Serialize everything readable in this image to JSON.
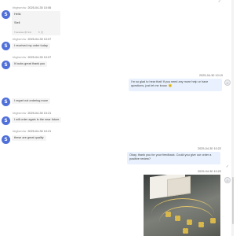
{
  "messages": {
    "m1": {
      "avatar": "S",
      "nick": "bbgtsmdw",
      "time": "2025-04-30 10:06",
      "lines": [
        "Hello",
        "Stell"
      ],
      "translate": "Translate  中  N/A",
      "translate_extra": "↻ 文"
    },
    "m2": {
      "avatar": "S",
      "nick": "bbgtsmdw",
      "time": "2025-04-30 10:07",
      "text": "I received my order today"
    },
    "m3": {
      "avatar": "S",
      "nick": "bbgtsmdw",
      "time": "2025-04-30 10:07",
      "text": "It looks great thank you"
    },
    "m4": {
      "time": "2025-04-30 10:19",
      "text": "I'm so glad to hear that! If you need any more help or have questions, just let me know. 😊"
    },
    "m5": {
      "avatar": "S",
      "text": "I regret not ordering more"
    },
    "m6": {
      "avatar": "S",
      "nick": "bbgtsmdw",
      "time": "2025-04-30 10:21",
      "text": "I will order again in the near future"
    },
    "m7": {
      "avatar": "S",
      "nick": "bbgtsmdw",
      "time": "2025-04-30 10:21",
      "text": "these are great quality"
    },
    "m8": {
      "time": "2025-04-30 10:22",
      "text": "Okay, thank you for your feedback. Could you give our order a positive review?"
    },
    "m9": {
      "time": "2025-04-30 10:22",
      "image_alt": "product-photo-necklace"
    }
  },
  "colors": {
    "avatar_bg": "#4f6fd9",
    "agent_bubble": "#e8f1fd",
    "customer_bubble": "#f4f4f4"
  }
}
